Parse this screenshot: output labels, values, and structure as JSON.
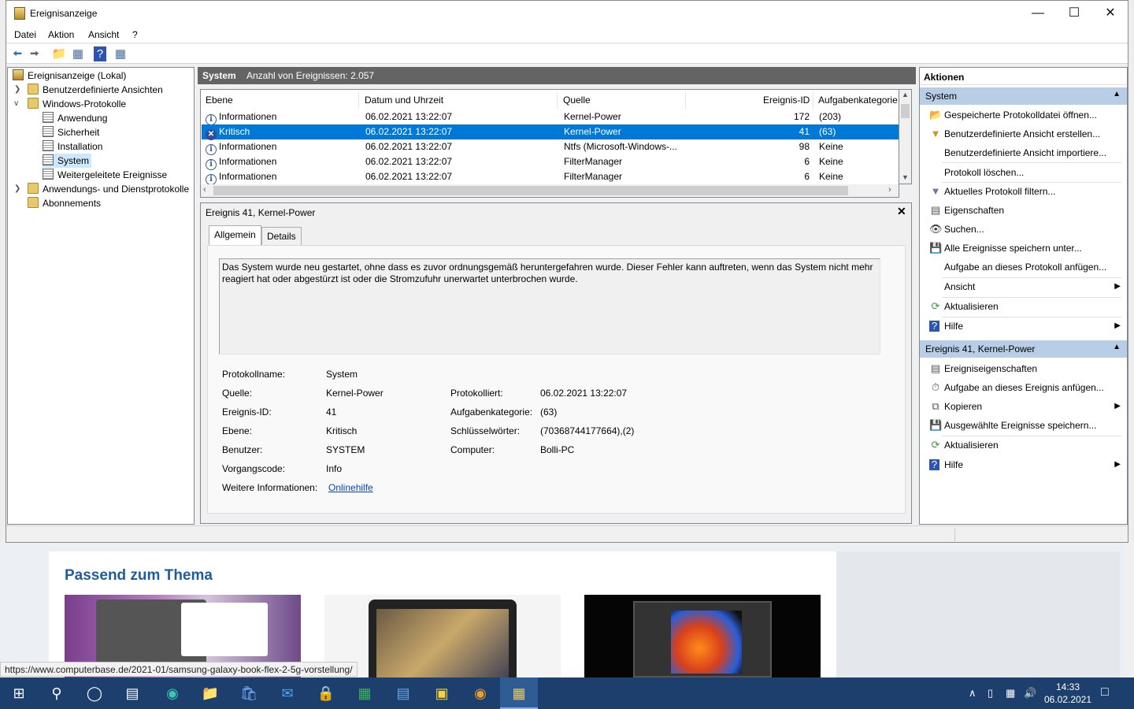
{
  "window": {
    "title": "Ereignisanzeige"
  },
  "menu": [
    "Datei",
    "Aktion",
    "Ansicht",
    "?"
  ],
  "tree": {
    "root": "Ereignisanzeige (Lokal)",
    "custom": "Benutzerdefinierte Ansichten",
    "winlogs": "Windows-Protokolle",
    "logs": [
      "Anwendung",
      "Sicherheit",
      "Installation",
      "System",
      "Weitergeleitete Ereignisse"
    ],
    "appsvc": "Anwendungs- und Dienstprotokolle",
    "subs": "Abonnements"
  },
  "center": {
    "title": "System",
    "count": "Anzahl von Ereignissen: 2.057"
  },
  "grid": {
    "columns": [
      "Ebene",
      "Datum und Uhrzeit",
      "Quelle",
      "Ereignis-ID",
      "Aufgabenkategorie"
    ],
    "rows": [
      {
        "level": "Informationen",
        "date": "06.02.2021 13:22:07",
        "source": "Kernel-Power",
        "id": "172",
        "cat": "(203)",
        "icon": "info-icon",
        "selected": false
      },
      {
        "level": "Kritisch",
        "date": "06.02.2021 13:22:07",
        "source": "Kernel-Power",
        "id": "41",
        "cat": "(63)",
        "icon": "critical-icon",
        "selected": true
      },
      {
        "level": "Informationen",
        "date": "06.02.2021 13:22:07",
        "source": "Ntfs (Microsoft-Windows-...",
        "id": "98",
        "cat": "Keine",
        "icon": "info-icon",
        "selected": false
      },
      {
        "level": "Informationen",
        "date": "06.02.2021 13:22:07",
        "source": "FilterManager",
        "id": "6",
        "cat": "Keine",
        "icon": "info-icon",
        "selected": false
      },
      {
        "level": "Informationen",
        "date": "06.02.2021 13:22:07",
        "source": "FilterManager",
        "id": "6",
        "cat": "Keine",
        "icon": "info-icon",
        "selected": false
      }
    ]
  },
  "detail": {
    "title": "Ereignis 41, Kernel-Power",
    "tabs": [
      "Allgemein",
      "Details"
    ],
    "description": "Das System wurde neu gestartet, ohne dass es zuvor ordnungsgemäß heruntergefahren wurde. Dieser Fehler kann auftreten, wenn das System nicht mehr reagiert hat oder abgestürzt ist oder die Stromzufuhr unerwartet unterbrochen wurde.",
    "fields": {
      "protokollname_l": "Protokollname:",
      "protokollname": "System",
      "quelle_l": "Quelle:",
      "quelle": "Kernel-Power",
      "protokolliert_l": "Protokolliert:",
      "protokolliert": "06.02.2021 13:22:07",
      "id_l": "Ereignis-ID:",
      "id": "41",
      "kat_l": "Aufgabenkategorie:",
      "kat": "(63)",
      "ebene_l": "Ebene:",
      "ebene": "Kritisch",
      "keys_l": "Schlüsselwörter:",
      "keys": "(70368744177664),(2)",
      "user_l": "Benutzer:",
      "user": "SYSTEM",
      "comp_l": "Computer:",
      "comp": "Bolli-PC",
      "op_l": "Vorgangscode:",
      "op": "Info",
      "more_l": "Weitere Informationen:",
      "more": "Onlinehilfe"
    }
  },
  "actions": {
    "header": "Aktionen",
    "group1": "System",
    "group1_items": [
      "Gespeicherte Protokolldatei öffnen...",
      "Benutzerdefinierte Ansicht erstellen...",
      "Benutzerdefinierte Ansicht importiere...",
      "Protokoll löschen...",
      "Aktuelles Protokoll filtern...",
      "Eigenschaften",
      "Suchen...",
      "Alle Ereignisse speichern unter...",
      "Aufgabe an dieses Protokoll anfügen...",
      "Ansicht",
      "Aktualisieren",
      "Hilfe"
    ],
    "group2": "Ereignis 41, Kernel-Power",
    "group2_items": [
      "Ereigniseigenschaften",
      "Aufgabe an dieses Ereignis anfügen...",
      "Kopieren",
      "Ausgewählte Ereignisse speichern...",
      "Aktualisieren",
      "Hilfe"
    ]
  },
  "background": {
    "heading": "Passend zum Thema",
    "status_url": "https://www.computerbase.de/2021-01/samsung-galaxy-book-flex-2-5g-vorstellung/"
  },
  "taskbar": {
    "time": "14:33",
    "date": "06.02.2021"
  }
}
